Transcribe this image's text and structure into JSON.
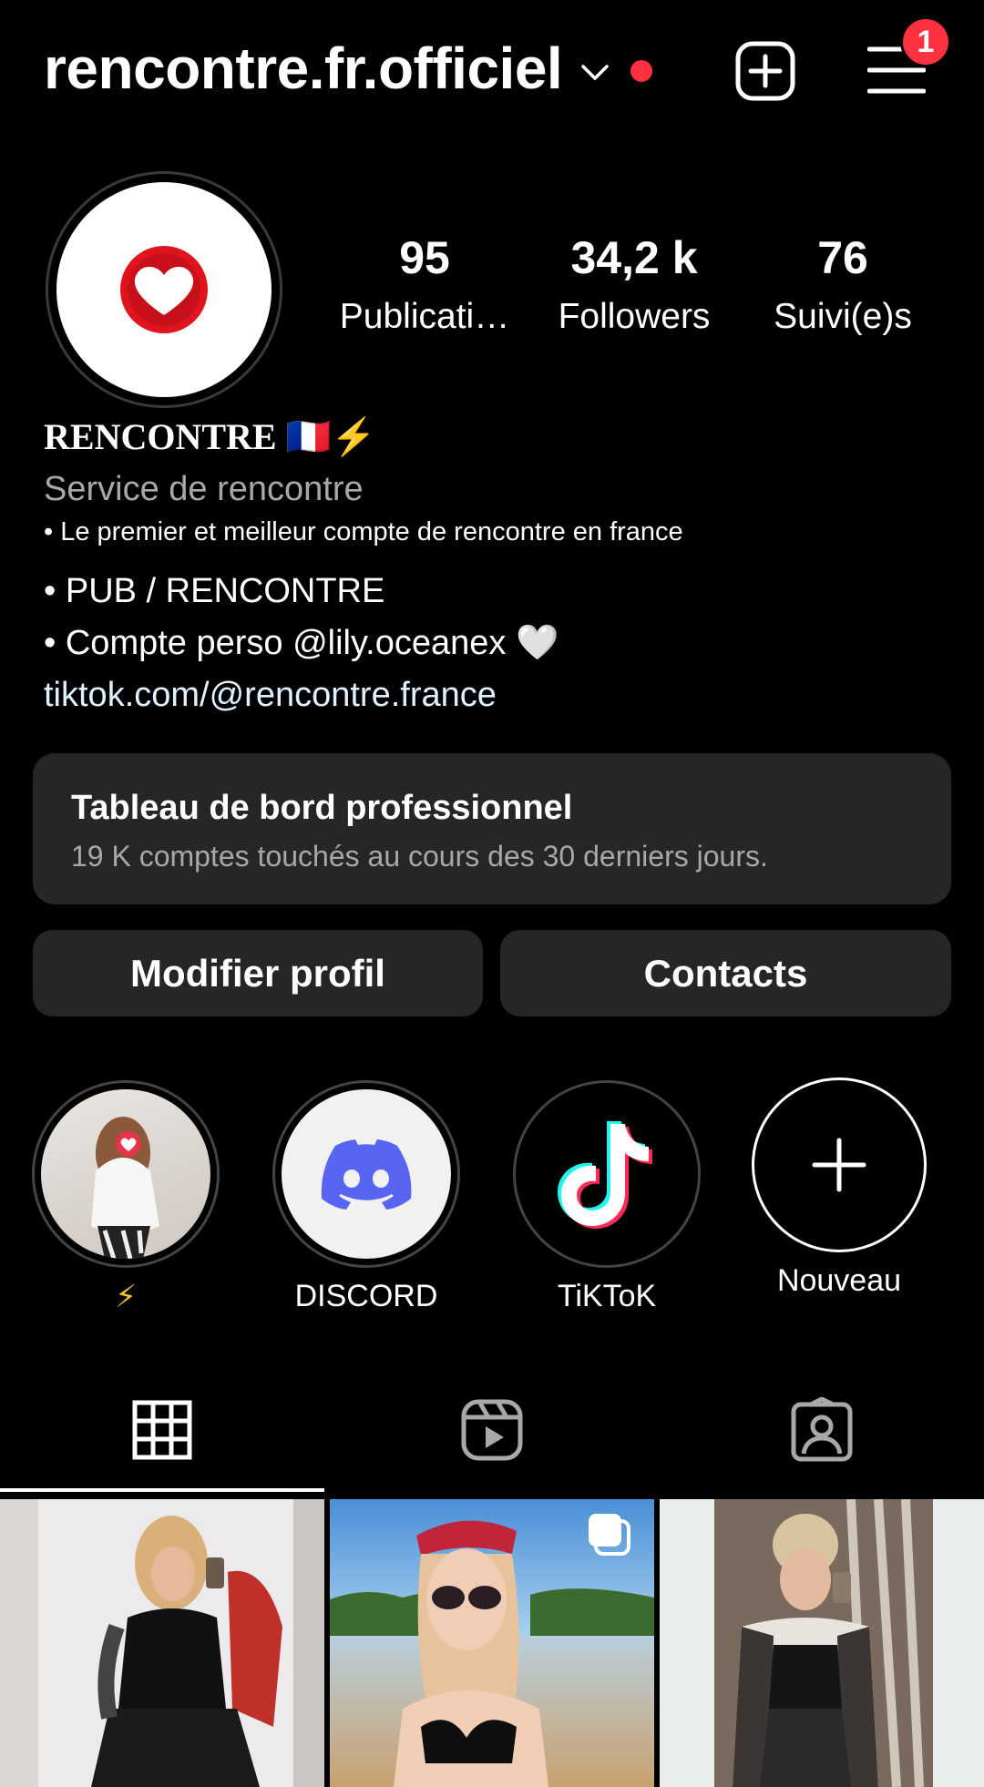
{
  "header": {
    "username": "rencontre.fr.officiel",
    "notification_count": "1"
  },
  "stats": [
    {
      "value": "95",
      "label": "Publicati…"
    },
    {
      "value": "34,2 k",
      "label": "Followers"
    },
    {
      "value": "76",
      "label": "Suivi(e)s"
    }
  ],
  "bio": {
    "name": "RENCONTRE 🇫🇷⚡",
    "category": "Service de rencontre",
    "line1": "• Le premier et meilleur compte de rencontre en france",
    "line2": "• PUB / RENCONTRE",
    "line3": "• Compte perso @lily.oceanex 🤍",
    "link": "tiktok.com/@rencontre.france"
  },
  "dashboard": {
    "title": "Tableau de bord professionnel",
    "subtitle": "19 K comptes touchés au cours des 30 derniers jours."
  },
  "buttons": {
    "edit_profile": "Modifier profil",
    "contacts": "Contacts"
  },
  "highlights": [
    {
      "label": "⚡"
    },
    {
      "label": "DISCORD"
    },
    {
      "label": "TiKToK"
    },
    {
      "label": "Nouveau"
    }
  ],
  "colors": {
    "background": "#000000",
    "surface": "#262626",
    "accent_red": "#ff3040",
    "muted_text": "#a8a8a8",
    "discord": "#5865f2"
  },
  "tabs": [
    "grid-icon",
    "reels-icon",
    "tagged-icon"
  ]
}
